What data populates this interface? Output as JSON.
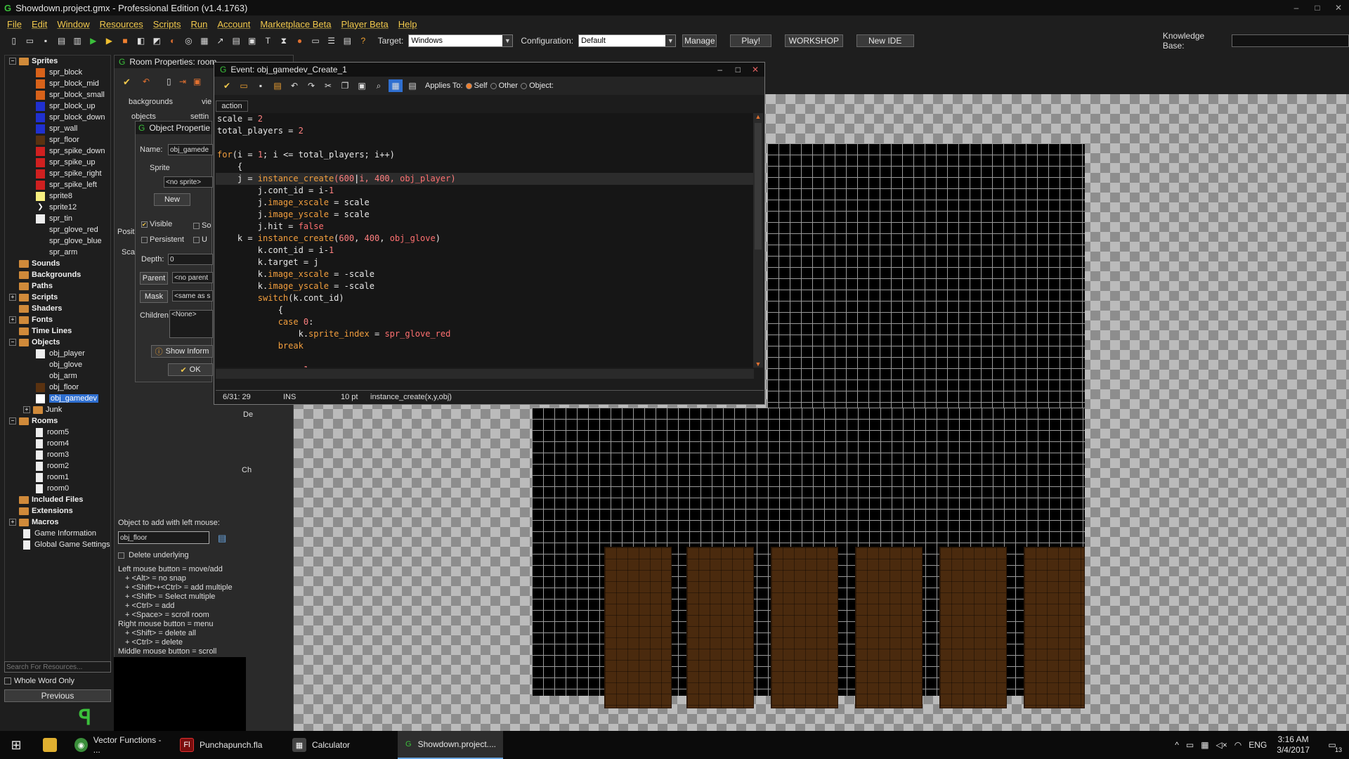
{
  "window": {
    "title": "Showdown.project.gmx  -  Professional Edition (v1.4.1763)"
  },
  "menu": [
    "File",
    "Edit",
    "Window",
    "Resources",
    "Scripts",
    "Run",
    "Account",
    "Marketplace Beta",
    "Player Beta",
    "Help"
  ],
  "toolbar": {
    "target_label": "Target:",
    "target_value": "Windows",
    "config_label": "Configuration:",
    "config_value": "Default",
    "manage": "Manage",
    "play": "Play!",
    "workshop": "WORKSHOP",
    "new_ide": "New IDE",
    "kb_label": "Knowledge Base:"
  },
  "tree": {
    "sprites": "Sprites",
    "sprite_items": [
      "spr_block",
      "spr_block_mid",
      "spr_block_small",
      "spr_block_up",
      "spr_block_down",
      "spr_wall",
      "spr_floor",
      "spr_spike_down",
      "spr_spike_up",
      "spr_spike_right",
      "spr_spike_left",
      "sprite8",
      "sprite12",
      "spr_tin",
      "spr_glove_red",
      "spr_glove_blue",
      "spr_arm"
    ],
    "sounds": "Sounds",
    "backgrounds": "Backgrounds",
    "paths": "Paths",
    "scripts": "Scripts",
    "shaders": "Shaders",
    "fonts": "Fonts",
    "timelines": "Time Lines",
    "objects": "Objects",
    "object_items": [
      "obj_player",
      "obj_glove",
      "obj_arm",
      "obj_floor",
      "obj_gamedev"
    ],
    "junk": "Junk",
    "rooms": "Rooms",
    "room_items": [
      "room5",
      "room4",
      "room3",
      "room2",
      "room1",
      "room0"
    ],
    "included": "Included Files",
    "extensions": "Extensions",
    "macros": "Macros",
    "game_info": "Game Information",
    "global_settings": "Global Game Settings",
    "search_placeholder": "Search For Resources...",
    "whole_word": "Whole Word Only",
    "previous": "Previous"
  },
  "room_props": {
    "title": "Room Properties: room",
    "tab_backgrounds": "backgrounds",
    "tab_views": "vie",
    "tab_objects": "objects",
    "tab_settings": "settin",
    "add_label": "Object to add with left mouse:",
    "add_value": "obj_floor",
    "delete_underlying": "Delete underlying",
    "help": [
      "Left mouse button = move/add",
      "+ <Alt> = no snap",
      "+ <Shift>+<Ctrl> = add multiple",
      "+ <Shift> = Select multiple",
      "+ <Ctrl> = add",
      "+ <Space> = scroll room",
      "Right mouse button = menu",
      "+ <Shift> = delete all",
      "+ <Ctrl> = delete",
      "Middle mouse button = scroll"
    ],
    "side_pos": "Positi",
    "side_sca": "Sca",
    "side_na": "Na",
    "side_de": "De",
    "side_ch": "Ch"
  },
  "obj_props": {
    "title": "Object Propertie",
    "name_label": "Name:",
    "name_value": "obj_gamede",
    "sprite_label": "Sprite",
    "sprite_value": "<no sprite>",
    "new_btn": "New",
    "visible": "Visible",
    "solid": "So",
    "persistent": "Persistent",
    "uses": "U",
    "depth_label": "Depth:",
    "depth_value": "0",
    "parent_btn": "Parent",
    "parent_value": "<no parent",
    "mask_btn": "Mask",
    "mask_value": "<same as s",
    "children_label": "Children:",
    "children_value": "<None>",
    "show_info": "Show Inform",
    "ok": "OK"
  },
  "editor": {
    "title": "Event: obj_gamedev_Create_1",
    "applies_to": "Applies To:",
    "self": "Self",
    "other": "Other",
    "object": "Object:",
    "tab": "action",
    "status_pos": "6/31: 29",
    "status_mode": "INS",
    "status_size": "10 pt",
    "status_hint": "instance_create(x,y,obj)"
  },
  "taskbar": {
    "items": [
      "Vector Functions - ...",
      "Punchapunch.fla",
      "Calculator",
      "Showdown.project...."
    ],
    "time": "3:16 AM",
    "date": "3/4/2017",
    "lang": "ENG",
    "notif": "13"
  }
}
